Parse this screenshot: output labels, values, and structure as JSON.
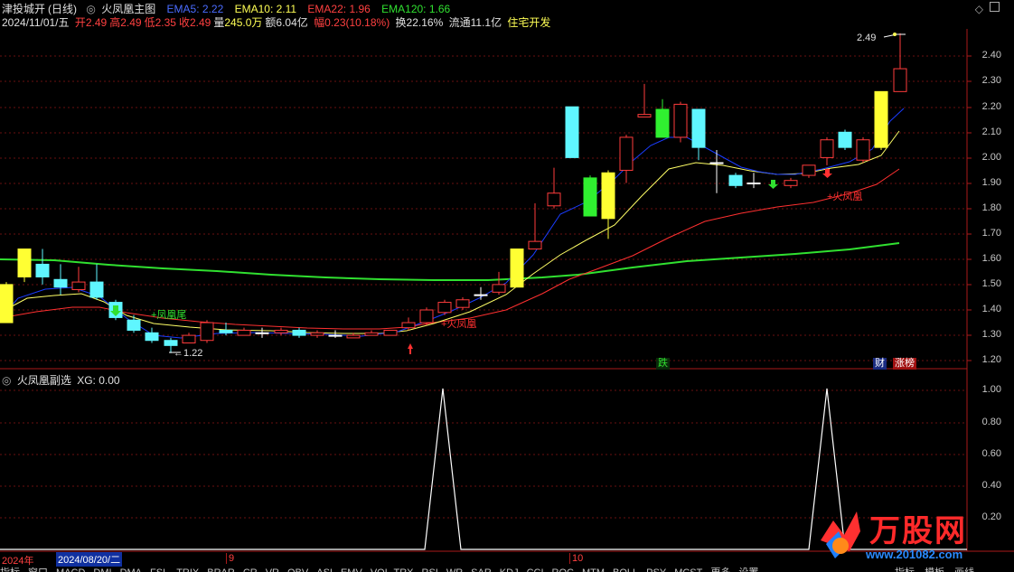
{
  "stock": {
    "name": "津投城开",
    "period": "(日线)"
  },
  "main_indicator": {
    "name": "火凤凰主图"
  },
  "ema": [
    {
      "label": "EMA5: 2.22",
      "color": "#3050ff"
    },
    {
      "label": "EMA10: 2.11",
      "color": "#ffff55"
    },
    {
      "label": "EMA22: 1.96",
      "color": "#ff4040"
    },
    {
      "label": "EMA120: 1.66",
      "color": "#30e030"
    }
  ],
  "quote": {
    "date": "2024/11/01/五",
    "open_label": "开",
    "open": "2.49",
    "high_label": "高",
    "high": "2.49",
    "low_label": "低",
    "low": "2.35",
    "close_label": "收",
    "close": "2.49",
    "volume_label": "量",
    "volume": "245.0万",
    "amount_label": "额",
    "amount": "6.04亿",
    "change_label": "幅",
    "change": "0.23(10.18%)",
    "turnover_label": "换",
    "turnover": "22.16%",
    "float_label": "流通",
    "float": "11.1亿",
    "sector": "住宅开发"
  },
  "price_axis": [
    "2.40",
    "2.30",
    "2.20",
    "2.10",
    "2.00",
    "1.90",
    "1.80",
    "1.70",
    "1.60",
    "1.50",
    "1.40",
    "1.30",
    "1.20"
  ],
  "annotations": {
    "peak_value": "2.49",
    "low_value": "1.22",
    "phoenix_tail": "+凤凰尾",
    "fire_phoenix_1": "+火凤凰",
    "fire_phoenix_2": "+火凤凰",
    "fall_tag": "跌",
    "finance_tag": "财",
    "limit_tag": "涨榜"
  },
  "sub_indicator": {
    "name": "火凤凰副选",
    "xg": "XG: 0.00"
  },
  "sub_axis": [
    "1.00",
    "0.80",
    "0.60",
    "0.40",
    "0.20"
  ],
  "time_axis": {
    "year": "2024年",
    "cursor": "2024/08/20/二",
    "m9": "9",
    "m10": "10"
  },
  "tabs": [
    "指标",
    "窗口",
    "MACD",
    "DMI",
    "DMA",
    "FSL",
    "TRIX",
    "BRAR",
    "CR",
    "VR",
    "OBV",
    "ASI",
    "EMV",
    "VOL-TRX",
    "RSI",
    "WR",
    "SAR",
    "KDJ",
    "CCI",
    "ROC",
    "MTM",
    "BOLL",
    "PSY",
    "MCST",
    "更多",
    "设置"
  ],
  "right_tabs": [
    "指标",
    "模板",
    "画线"
  ],
  "watermark": {
    "brand": "万股网",
    "url": "www.201082.com"
  },
  "colors": {
    "up": "#ff3c3c",
    "down": "#5ff6ff",
    "grid": "#7a1010",
    "bg": "#000000"
  }
}
